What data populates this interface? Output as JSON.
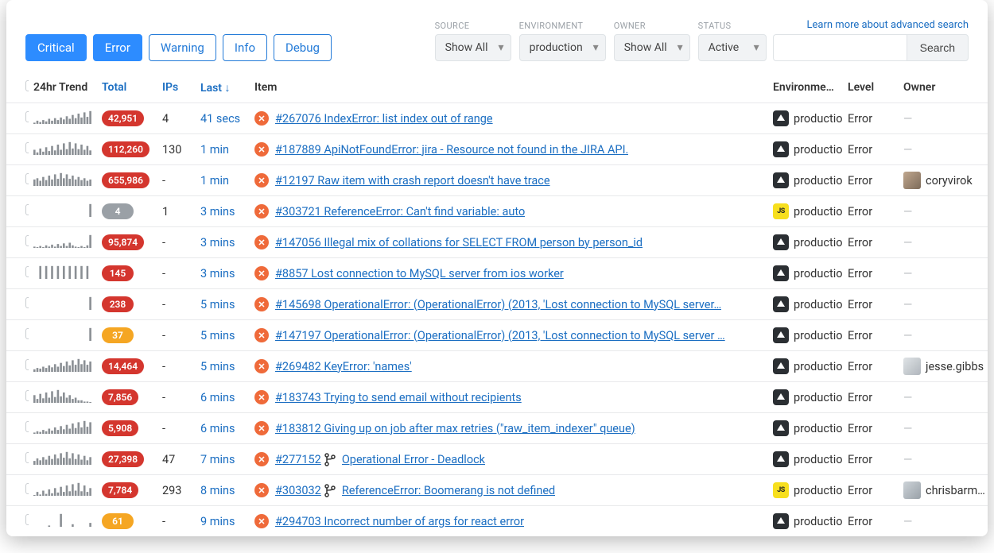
{
  "toolbar": {
    "levels": [
      {
        "label": "Critical",
        "style": "blue"
      },
      {
        "label": "Error",
        "style": "blue"
      },
      {
        "label": "Warning",
        "style": "outline"
      },
      {
        "label": "Info",
        "style": "outline"
      },
      {
        "label": "Debug",
        "style": "outline"
      }
    ],
    "filters": {
      "source": {
        "label": "SOURCE",
        "value": "Show All"
      },
      "environment": {
        "label": "ENVIRONMENT",
        "value": "production"
      },
      "owner": {
        "label": "OWNER",
        "value": "Show All"
      },
      "status": {
        "label": "STATUS",
        "value": "Active"
      }
    },
    "search": {
      "learn_link": "Learn more about advanced search",
      "button": "Search"
    }
  },
  "columns": {
    "trend": "24hr Trend",
    "total": "Total",
    "ips": "IPs",
    "last": "Last",
    "item": "Item",
    "env": "Environmen…",
    "level": "Level",
    "owner": "Owner"
  },
  "rows": [
    {
      "total": "42,951",
      "total_style": "red",
      "ips": "4",
      "last": "41 secs",
      "id": "#267076",
      "title": "IndexError: list index out of range",
      "platform": "dark",
      "merged": false,
      "env": "production",
      "level": "Error",
      "owner": null,
      "spark": [
        2,
        5,
        3,
        6,
        4,
        8,
        5,
        9,
        6,
        10,
        7,
        12,
        8,
        14,
        9,
        16,
        10,
        18,
        11,
        20
      ]
    },
    {
      "total": "112,260",
      "total_style": "red",
      "ips": "130",
      "last": "1 min",
      "id": "#187889",
      "title": "ApiNotFoundError: jira - Resource not found in the JIRA API.",
      "platform": "dark",
      "merged": false,
      "env": "production",
      "level": "Error",
      "owner": null,
      "spark": [
        8,
        4,
        10,
        5,
        12,
        6,
        14,
        7,
        16,
        8,
        18,
        9,
        20,
        10,
        18,
        9,
        16,
        8,
        14,
        7
      ]
    },
    {
      "total": "655,986",
      "total_style": "red",
      "ips": "-",
      "last": "1 min",
      "id": "#12197",
      "title": "Raw item with crash report doesn't have trace",
      "platform": "dark",
      "merged": false,
      "env": "production",
      "level": "Error",
      "owner": {
        "name": "coryvirok",
        "avatar": "a"
      },
      "spark": [
        10,
        12,
        8,
        14,
        9,
        16,
        10,
        18,
        11,
        20,
        12,
        18,
        11,
        16,
        10,
        14,
        9,
        12,
        8,
        10
      ]
    },
    {
      "total": "4",
      "total_style": "grey",
      "ips": "1",
      "last": "3 mins",
      "id": "#303721",
      "title": "ReferenceError: Can't find variable: auto",
      "platform": "js",
      "merged": false,
      "env": "production",
      "level": "Error",
      "owner": null,
      "spark": [
        0,
        0,
        0,
        0,
        0,
        0,
        0,
        0,
        0,
        0,
        0,
        0,
        0,
        0,
        0,
        0,
        0,
        0,
        0,
        20
      ]
    },
    {
      "total": "95,874",
      "total_style": "red",
      "ips": "-",
      "last": "3 mins",
      "id": "#147056",
      "title": "Illegal mix of collations for SELECT FROM person by person_id",
      "platform": "dark",
      "merged": false,
      "env": "production",
      "level": "Error",
      "owner": null,
      "spark": [
        2,
        1,
        3,
        1,
        4,
        2,
        5,
        2,
        6,
        3,
        7,
        3,
        8,
        4,
        2,
        1,
        3,
        1,
        4,
        20
      ]
    },
    {
      "total": "145",
      "total_style": "red",
      "ips": "-",
      "last": "3 mins",
      "id": "#8857",
      "title": "Lost connection to MySQL server from ios worker",
      "platform": "dark",
      "merged": false,
      "env": "production",
      "level": "Error",
      "owner": null,
      "spark": [
        0,
        0,
        1,
        0,
        1,
        0,
        1,
        0,
        1,
        0,
        1,
        0,
        1,
        0,
        1,
        0,
        1,
        0,
        1,
        0
      ]
    },
    {
      "total": "238",
      "total_style": "red",
      "ips": "-",
      "last": "5 mins",
      "id": "#145698",
      "title": "OperationalError: (OperationalError) (2013, 'Lost connection to MySQL server…",
      "platform": "dark",
      "merged": false,
      "env": "production",
      "level": "Error",
      "owner": null,
      "spark": [
        0,
        0,
        0,
        0,
        0,
        0,
        0,
        0,
        0,
        0,
        0,
        0,
        0,
        0,
        0,
        0,
        0,
        0,
        0,
        20
      ]
    },
    {
      "total": "37",
      "total_style": "amber",
      "ips": "-",
      "last": "5 mins",
      "id": "#147197",
      "title": "OperationalError: (OperationalError) (2013, 'Lost connection to MySQL server …",
      "platform": "dark",
      "merged": false,
      "env": "production",
      "level": "Error",
      "owner": null,
      "spark": [
        0,
        0,
        0,
        0,
        0,
        0,
        0,
        0,
        0,
        0,
        0,
        0,
        0,
        0,
        0,
        0,
        0,
        0,
        0,
        20
      ]
    },
    {
      "total": "14,464",
      "total_style": "red",
      "ips": "-",
      "last": "5 mins",
      "id": "#269482",
      "title": "KeyError: 'names'",
      "platform": "dark",
      "merged": false,
      "env": "production",
      "level": "Error",
      "owner": {
        "name": "jesse.gibbs",
        "avatar": "b"
      },
      "spark": [
        4,
        6,
        5,
        8,
        6,
        10,
        7,
        12,
        8,
        14,
        9,
        16,
        10,
        18,
        11,
        20,
        12,
        18,
        11,
        16
      ]
    },
    {
      "total": "7,856",
      "total_style": "red",
      "ips": "-",
      "last": "6 mins",
      "id": "#183743",
      "title": "Trying to send email without recipients",
      "platform": "dark",
      "merged": false,
      "env": "production",
      "level": "Error",
      "owner": null,
      "spark": [
        12,
        6,
        14,
        7,
        16,
        8,
        18,
        9,
        20,
        10,
        16,
        8,
        12,
        6,
        8,
        4,
        4,
        2,
        2,
        1
      ]
    },
    {
      "total": "5,908",
      "total_style": "red",
      "ips": "-",
      "last": "6 mins",
      "id": "#183812",
      "title": "Giving up on job after max retries (\"raw_item_indexer\" queue)",
      "platform": "dark",
      "merged": false,
      "env": "production",
      "level": "Error",
      "owner": null,
      "spark": [
        2,
        4,
        3,
        6,
        4,
        8,
        5,
        10,
        6,
        12,
        7,
        14,
        8,
        16,
        9,
        18,
        10,
        20,
        11,
        18
      ]
    },
    {
      "total": "27,398",
      "total_style": "red",
      "ips": "47",
      "last": "7 mins",
      "id": "#277152",
      "title": "Operational Error - Deadlock",
      "platform": "dark",
      "merged": true,
      "env": "production",
      "level": "Error",
      "owner": null,
      "spark": [
        6,
        10,
        7,
        12,
        8,
        14,
        9,
        16,
        10,
        18,
        11,
        20,
        10,
        18,
        9,
        16,
        8,
        14,
        7,
        12
      ]
    },
    {
      "total": "7,784",
      "total_style": "red",
      "ips": "293",
      "last": "8 mins",
      "id": "#303032",
      "title": "ReferenceError: Boomerang is not defined",
      "platform": "js",
      "merged": true,
      "env": "production",
      "level": "Error",
      "owner": {
        "name": "chrisbarm…",
        "avatar": "c"
      },
      "spark": [
        1,
        6,
        2,
        8,
        3,
        10,
        4,
        12,
        5,
        14,
        6,
        16,
        7,
        18,
        8,
        20,
        7,
        16,
        6,
        12
      ]
    },
    {
      "total": "61",
      "total_style": "amber",
      "ips": "-",
      "last": "9 mins",
      "id": "#294703",
      "title": "Incorrect number of args for react error",
      "platform": "dark",
      "merged": false,
      "env": "production",
      "level": "Error",
      "owner": null,
      "spark": [
        0,
        0,
        0,
        0,
        0,
        2,
        0,
        0,
        0,
        20,
        0,
        0,
        0,
        4,
        0,
        0,
        0,
        0,
        0,
        6
      ]
    }
  ]
}
